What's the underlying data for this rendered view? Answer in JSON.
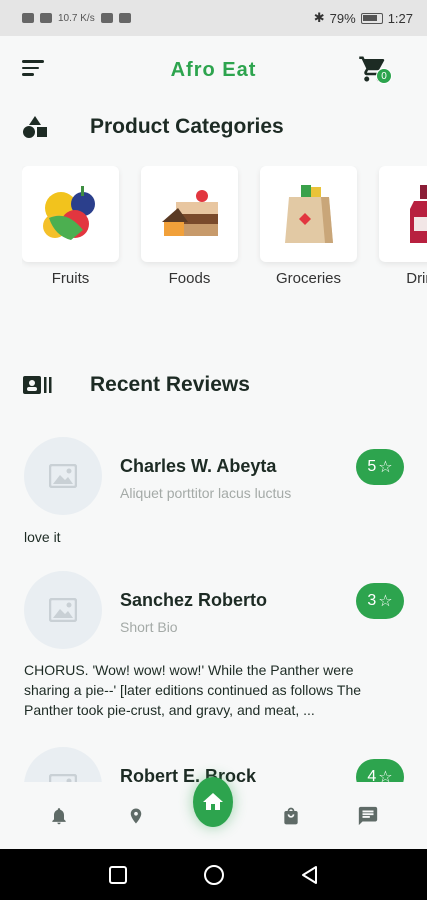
{
  "status_bar": {
    "network": "10.7 K/s",
    "battery": "79%",
    "time": "1:27"
  },
  "header": {
    "title": "Afro Eat",
    "cart_count": "0"
  },
  "categories_section": {
    "title": "Product Categories",
    "items": [
      {
        "label": "Fruits",
        "icon": "fruits-icon"
      },
      {
        "label": "Foods",
        "icon": "cake-icon"
      },
      {
        "label": "Groceries",
        "icon": "grocery-bag-icon"
      },
      {
        "label": "Drinks",
        "icon": "bottle-icon"
      }
    ]
  },
  "reviews_section": {
    "title": "Recent Reviews",
    "items": [
      {
        "name": "Charles W. Abeyta",
        "bio": "Aliquet porttitor lacus luctus",
        "rating": "5",
        "text": "love it"
      },
      {
        "name": "Sanchez Roberto",
        "bio": "Short Bio",
        "rating": "3",
        "text": "CHORUS. 'Wow! wow! wow!' While the Panther were sharing a pie--' [later editions continued as follows The Panther took pie-crust, and gravy, and meat, ..."
      },
      {
        "name": "Robert E. Brock",
        "bio": "",
        "rating": "4",
        "text": ""
      }
    ]
  },
  "bottom_nav": [
    "bell-icon",
    "location-icon",
    "home-icon",
    "shopping-bag-icon",
    "chat-icon"
  ],
  "colors": {
    "accent": "#2da44e",
    "text": "#1d2b24",
    "muted": "#a4aaa7",
    "background": "#f7f8f8"
  }
}
